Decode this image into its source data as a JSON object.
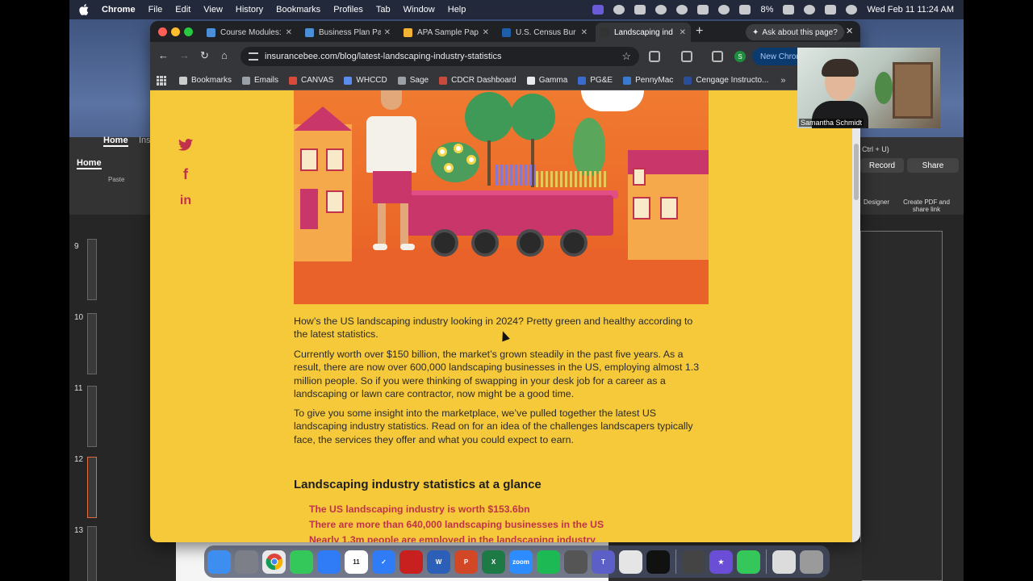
{
  "menubar": {
    "app_name": "Chrome",
    "menus": [
      "File",
      "Edit",
      "View",
      "History",
      "Bookmarks",
      "Profiles",
      "Tab",
      "Window",
      "Help"
    ],
    "battery": "8%",
    "datetime": "Wed Feb 11  11:24 AM"
  },
  "office": {
    "home_tab": "Home",
    "home_tab2": "Home",
    "insert_tab": "Ins",
    "paste_label": "Paste",
    "slide_numbers": [
      "9",
      "10",
      "11",
      "12",
      "13"
    ],
    "shortcut_hint": "Ctrl + U)",
    "record_label": "Record",
    "share_label": "Share",
    "designer_label": "Designer",
    "create_pdf_label": "Create PDF and share link"
  },
  "chrome": {
    "tabs": [
      {
        "title": "Course Modules:",
        "favicon_color": "#4a8fd8"
      },
      {
        "title": "Business Plan Pa",
        "favicon_color": "#4a8fd8"
      },
      {
        "title": "APA Sample Pap",
        "favicon_color": "#f2b233"
      },
      {
        "title": "U.S. Census Bur",
        "favicon_color": "#1f5ea8"
      },
      {
        "title": "Landscaping ind",
        "favicon_color": "#333333"
      }
    ],
    "ask_pill": "Ask about this page?",
    "url": "insurancebee.com/blog/latest-landscaping-industry-statistics",
    "profile_letter": "S",
    "new_chrome_label": "New Chrom",
    "bookmarks": [
      {
        "label": "Bookmarks",
        "color": "#cccccc"
      },
      {
        "label": "Emails",
        "color": "#9aa0a6"
      },
      {
        "label": "CANVAS",
        "color": "#d64b3b"
      },
      {
        "label": "WHCCD",
        "color": "#5b8def"
      },
      {
        "label": "Sage",
        "color": "#9aa0a6"
      },
      {
        "label": "CDCR Dashboard",
        "color": "#c94a3a"
      },
      {
        "label": "Gamma",
        "color": "#e8eaed"
      },
      {
        "label": "PG&E",
        "color": "#3b6ad1"
      },
      {
        "label": "PennyMac",
        "color": "#3b7ad1"
      },
      {
        "label": "Cengage Instructo...",
        "color": "#2b4e9b"
      }
    ]
  },
  "article": {
    "p1": "How’s the US landscaping industry looking in 2024? Pretty green and healthy according to the latest statistics.",
    "p2": "Currently worth over $150 billion, the market’s grown steadily in the past five years. As a result, there are now over 600,000 landscaping businesses in the US, employing almost 1.3 million people. So if you were thinking of swapping in your desk job for a career as a landscaping or lawn care contractor, now might be a good time.",
    "p3": "To give you some insight into the marketplace, we’ve pulled together the latest US landscaping industry statistics. Read on for an idea of the challenges landscapers typically face, the services they offer and what you could expect to earn.",
    "heading": "Landscaping industry statistics at a glance",
    "bullets": [
      "The US landscaping industry is worth $153.6bn",
      "There are more than 640,000 landscaping businesses in the US",
      "Nearly 1.3m people are employed in the landscaping industry"
    ]
  },
  "webcam": {
    "name": "Samantha Schmidt"
  },
  "dock": {
    "apps": [
      {
        "name": "finder",
        "color": "#3d8ef0",
        "label": ""
      },
      {
        "name": "launchpad",
        "color": "#7c7f88",
        "label": ""
      },
      {
        "name": "chrome",
        "color": "#e9e9e9",
        "label": ""
      },
      {
        "name": "messages",
        "color": "#34c759",
        "label": ""
      },
      {
        "name": "mail",
        "color": "#2f7cf6",
        "label": ""
      },
      {
        "name": "calendar",
        "color": "#ffffff",
        "label": "11"
      },
      {
        "name": "tasks",
        "color": "#2f7cf6",
        "label": "✓"
      },
      {
        "name": "acrobat",
        "color": "#c8201e",
        "label": ""
      },
      {
        "name": "word",
        "color": "#2b5fb8",
        "label": "W"
      },
      {
        "name": "powerpoint",
        "color": "#d24726",
        "label": "P"
      },
      {
        "name": "excel",
        "color": "#1d7a45",
        "label": "X"
      },
      {
        "name": "zoom",
        "color": "#2d8cff",
        "label": "zoom"
      },
      {
        "name": "spotify",
        "color": "#1db954",
        "label": ""
      },
      {
        "name": "calculator",
        "color": "#555555",
        "label": ""
      },
      {
        "name": "teams",
        "color": "#5b5fc7",
        "label": "T"
      },
      {
        "name": "files",
        "color": "#e5e5e5",
        "label": ""
      },
      {
        "name": "chatgpt",
        "color": "#111111",
        "label": ""
      },
      {
        "name": "utility",
        "color": "#444444",
        "label": ""
      },
      {
        "name": "imovie",
        "color": "#6a4fd6",
        "label": "★"
      },
      {
        "name": "phone",
        "color": "#34c759",
        "label": ""
      },
      {
        "name": "document",
        "color": "#dcdcdc",
        "label": ""
      },
      {
        "name": "trash",
        "color": "#9a9a9a",
        "label": ""
      }
    ]
  }
}
